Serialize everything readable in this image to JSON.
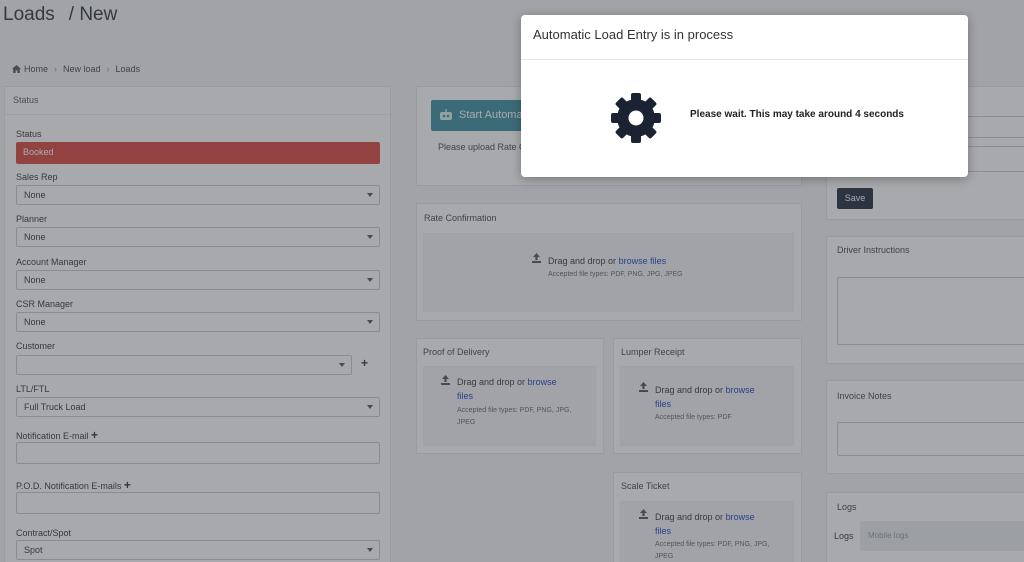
{
  "header": {
    "title": "Loads",
    "subtitle": "/ New"
  },
  "breadcrumb": {
    "home": "Home",
    "new_load": "New load",
    "loads": "Loads"
  },
  "status_panel": {
    "heading": "Status",
    "status_label": "Status",
    "status_value": "Booked",
    "status_color": "#d9463d",
    "sales_rep_label": "Sales Rep",
    "sales_rep_value": "None",
    "planner_label": "Planner",
    "planner_value": "None",
    "account_manager_label": "Account Manager",
    "account_manager_value": "None",
    "csr_manager_label": "CSR Manager",
    "csr_manager_value": "None",
    "customer_label": "Customer",
    "customer_value": "",
    "ltl_label": "LTL/FTL",
    "ltl_value": "Full Truck Load",
    "notification_email_label": "Notification E-mail",
    "pod_emails_label": "P.O.D. Notification E-mails",
    "contract_label": "Contract/Spot",
    "contract_value": "Spot"
  },
  "automation": {
    "button_label": "Start Automa",
    "upload_hint": "Please upload Rate C"
  },
  "rate_confirmation": {
    "heading": "Rate Confirmation",
    "drag_text": "Drag and drop or",
    "link_text": "browse files",
    "accepted": "Accepted file types: PDF, PNG, JPG, JPEG"
  },
  "proof_of_delivery": {
    "heading": "Proof of Delivery",
    "drag_text": "Drag and drop or",
    "link_text": "browse",
    "link_text_2": "files",
    "accepted": "Accepted file types: PDF, PNG, JPG,",
    "accepted_2": "JPEG"
  },
  "lumper_receipt": {
    "heading": "Lumper Receipt",
    "drag_text": "Drag and drop or",
    "link_text": "browse",
    "link_text_2": "files",
    "accepted": "Accepted file types: PDF"
  },
  "scale_ticket": {
    "heading": "Scale Ticket",
    "drag_text": "Drag and drop or",
    "link_text": "browse",
    "link_text_2": "files",
    "accepted": "Accepted file types: PDF, PNG, JPG,",
    "accepted_2": "JPEG"
  },
  "right_column": {
    "save_label": "Save",
    "driver_instructions": "Driver Instructions",
    "invoice_notes": "Invoice Notes",
    "logs_heading": "Logs",
    "logs_label": "Logs",
    "logs_placeholder": "Mobile logs"
  },
  "modal": {
    "title": "Automatic Load Entry is in process",
    "message": "Please wait. This may take around 4 seconds",
    "icon": "gear-icon"
  }
}
